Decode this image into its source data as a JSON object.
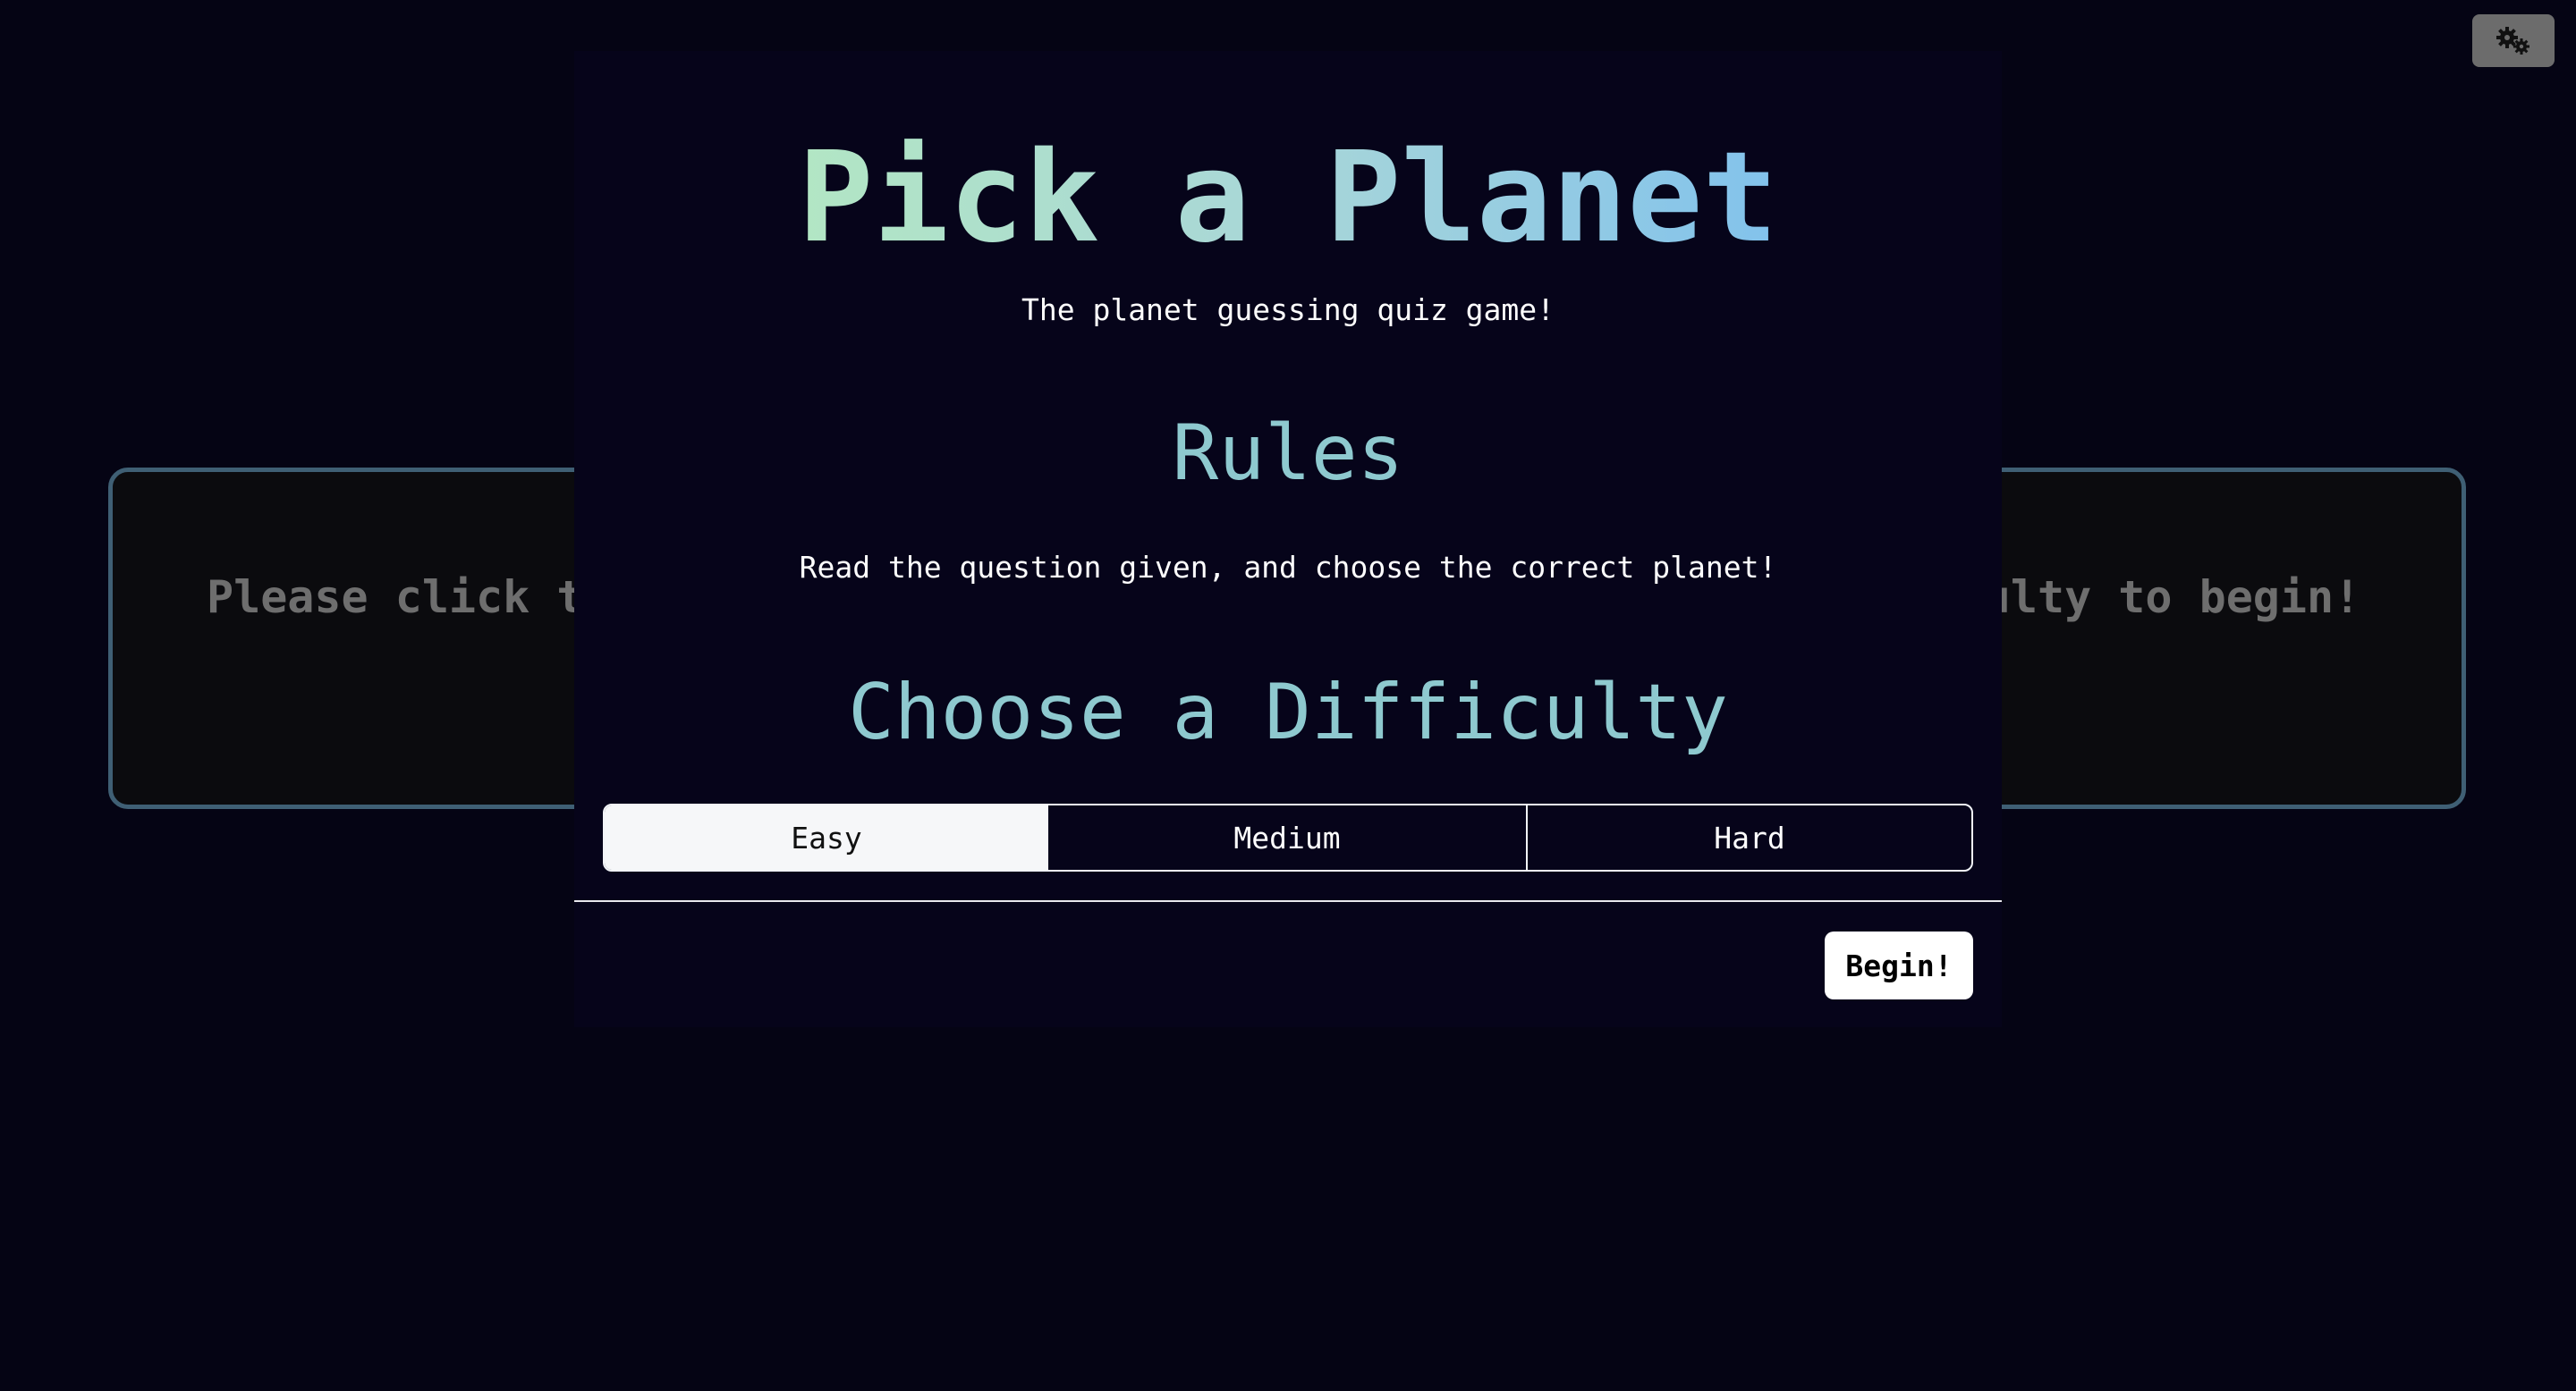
{
  "background_card": {
    "prompt": "Please click the button in the top-right corner to choose a difficulty to begin!"
  },
  "settings": {
    "icon": "gears-icon"
  },
  "modal": {
    "title": "Pick a Planet",
    "subtitle": "The planet guessing quiz game!",
    "rules_heading": "Rules",
    "rules_text": "Read the question given, and choose the correct planet!",
    "difficulty_heading": "Choose a Difficulty",
    "difficulties": [
      "Easy",
      "Medium",
      "Hard"
    ],
    "selected_difficulty": "Easy",
    "begin_label": "Begin!"
  },
  "colors": {
    "background": "#050414",
    "modal_background": "#06041a",
    "heading": "#8ec9cf",
    "title_gradient_start": "#b2e6c4",
    "title_gradient_end": "#82c2ec",
    "card_border": "#3f5f74"
  }
}
